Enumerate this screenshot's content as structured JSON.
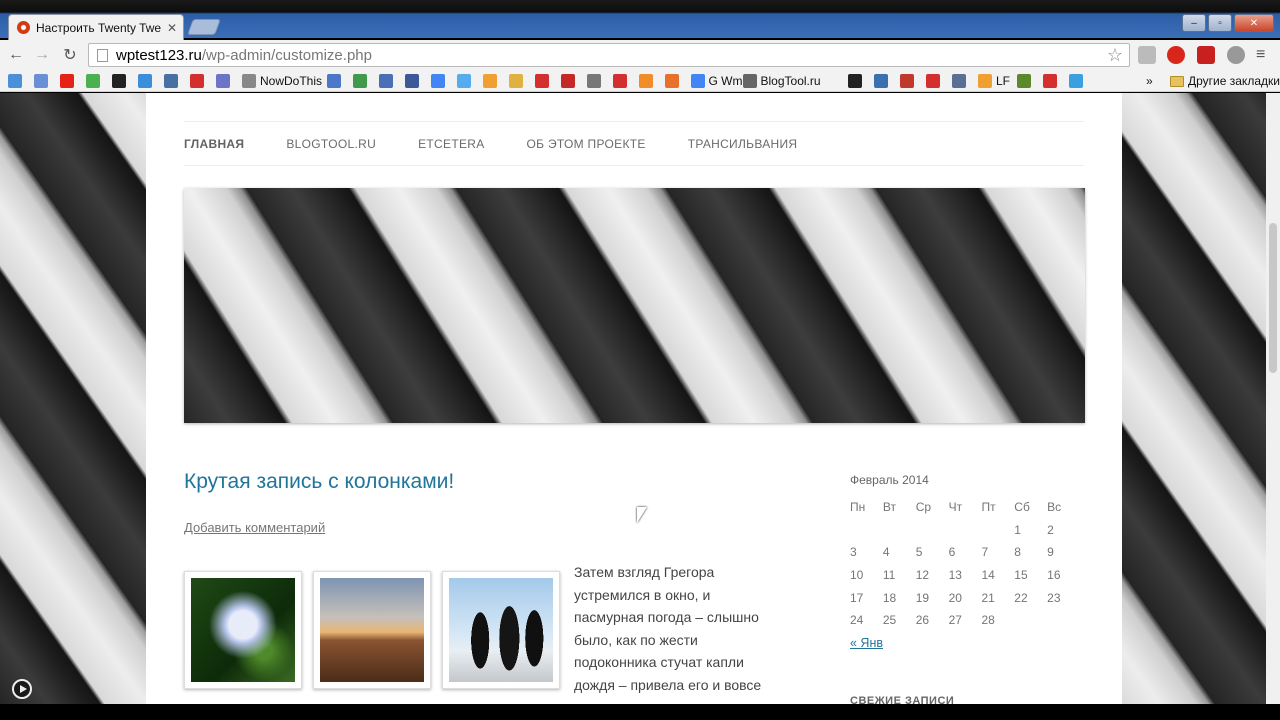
{
  "browser": {
    "tab_title": "Настроить Twenty Twelve",
    "tab_close": "✕",
    "url_host": "wptest123.ru",
    "url_path": "/wp-admin/customize.php",
    "window_buttons": [
      "‒",
      "▫",
      "✕"
    ],
    "nav": {
      "back": "←",
      "forward": "→",
      "reload": "↻"
    },
    "bookmarks": [
      {
        "label": "",
        "color": "#4a90d9"
      },
      {
        "label": "",
        "color": "#6a8fd6"
      },
      {
        "label": "",
        "color": "#e62117"
      },
      {
        "label": "",
        "color": "#4caf50"
      },
      {
        "label": "",
        "color": "#222222"
      },
      {
        "label": "",
        "color": "#3b8ed8"
      },
      {
        "label": "",
        "color": "#4a6fa5"
      },
      {
        "label": "",
        "color": "#d32f2f"
      },
      {
        "label": "",
        "color": "#6b74c7"
      },
      {
        "label": "NowDoThis",
        "color": "#888888"
      },
      {
        "label": "",
        "color": "#4e77c9"
      },
      {
        "label": "",
        "color": "#3f9b4a"
      },
      {
        "label": "",
        "color": "#4a6fb5"
      },
      {
        "label": "",
        "color": "#3b5998"
      },
      {
        "label": "",
        "color": "#4285f4"
      },
      {
        "label": "",
        "color": "#55acee"
      },
      {
        "label": "",
        "color": "#f0a030"
      },
      {
        "label": "",
        "color": "#e0b040"
      },
      {
        "label": "",
        "color": "#d32f2f"
      },
      {
        "label": "",
        "color": "#c62828"
      },
      {
        "label": "",
        "color": "#777777"
      },
      {
        "label": "",
        "color": "#d32f2f"
      },
      {
        "label": "",
        "color": "#f08c2a"
      },
      {
        "label": "",
        "color": "#e8702a"
      },
      {
        "label": "G Wm",
        "color": "#4285f4"
      },
      {
        "label": "BlogTool.ru",
        "color": "#666666"
      }
    ],
    "bookmarks_tail": [
      {
        "label": "",
        "color": "#222222"
      },
      {
        "label": "",
        "color": "#3a6fb0"
      },
      {
        "label": "",
        "color": "#c0392b"
      },
      {
        "label": "",
        "color": "#d32f2f"
      },
      {
        "label": "",
        "color": "#5a6f93"
      },
      {
        "label": "LF",
        "color": "#f0a030"
      },
      {
        "label": "",
        "color": "#5c8a2a"
      },
      {
        "label": "",
        "color": "#d32f2f"
      },
      {
        "label": "",
        "color": "#3aa0e0"
      }
    ],
    "overflow": "»",
    "other_bookmarks": "Другие закладки"
  },
  "site": {
    "nav": [
      "ГЛАВНАЯ",
      "BLOGTOOL.RU",
      "ETCETERA",
      "ОБ ЭТОМ ПРОЕКТЕ",
      "ТРАНСИЛЬВАНИЯ"
    ],
    "post": {
      "title": "Крутая запись с колонками!",
      "comment_link": "Добавить комментарий",
      "text": "Затем взгляд Грегора устремился в окно, и пасмурная погода – слышно было, как по жести подоконника стучат капли дождя – привела его и вовсе"
    },
    "calendar": {
      "caption": "Февраль 2014",
      "weekdays": [
        "Пн",
        "Вт",
        "Ср",
        "Чт",
        "Пт",
        "Сб",
        "Вс"
      ],
      "weeks": [
        [
          "",
          "",
          "",
          "",
          "",
          "1",
          "2"
        ],
        [
          "3",
          "4",
          "5",
          "6",
          "7",
          "8",
          "9"
        ],
        [
          "10",
          "11",
          "12",
          "13",
          "14",
          "15",
          "16"
        ],
        [
          "17",
          "18",
          "19",
          "20",
          "21",
          "22",
          "23"
        ],
        [
          "24",
          "25",
          "26",
          "27",
          "28",
          "",
          ""
        ]
      ],
      "prev_link": "« Янв"
    },
    "next_widget_title": "СВЕЖИЕ ЗАПИСИ"
  },
  "colors": {
    "link": "#21759b",
    "chrome_blue": "#3b6fb8"
  }
}
